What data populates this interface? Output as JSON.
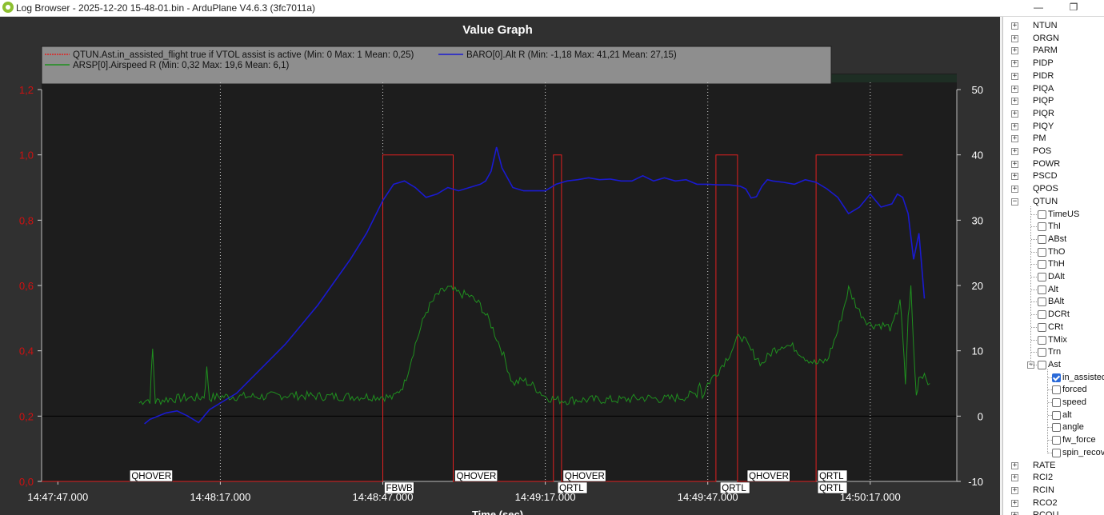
{
  "window": {
    "title": "Log Browser - 2025-12-20 15-48-01.bin - ArduPlane V4.6.3 (3fc7011a)",
    "min_label": "—",
    "max_label": "❐"
  },
  "colors": {
    "series_ast": "#e02020",
    "series_baro": "#1a1ad0",
    "series_arsp": "#1f8f1f",
    "left_axis_text": "#d01010"
  },
  "chart_data": {
    "type": "line",
    "title": "Value Graph",
    "xlabel": "Time (sec)",
    "x_range_sec": [
      -3,
      138
    ],
    "x_ticks": [
      {
        "t": 0,
        "label": "14:47:47.000"
      },
      {
        "t": 30,
        "label": "14:48:17.000"
      },
      {
        "t": 60,
        "label": "14:48:47.000"
      },
      {
        "t": 90,
        "label": "14:49:17.000"
      },
      {
        "t": 120,
        "label": "14:49:47.000"
      },
      {
        "t": 150,
        "label": "14:50:17.000"
      }
    ],
    "y_left": {
      "range": [
        0,
        1.2
      ],
      "ticks": [
        "0,0",
        "0,2",
        "0,4",
        "0,6",
        "0,8",
        "1,0",
        "1,2"
      ],
      "values": [
        0,
        0.2,
        0.4,
        0.6,
        0.8,
        1.0,
        1.2
      ]
    },
    "y_right": {
      "range": [
        -10,
        50
      ],
      "ticks": [
        "-10",
        "0",
        "10",
        "20",
        "30",
        "40",
        "50"
      ],
      "values": [
        -10,
        0,
        10,
        20,
        30,
        40,
        50
      ]
    },
    "legend": [
      {
        "name": "QTUN.Ast.in_assisted_flight true if VTOL assist is active (Min: 0 Max: 1 Mean: 0,25)",
        "color": "#e02020"
      },
      {
        "name": "BARO[0].Alt  R (Min: -1,18 Max: 41,21 Mean: 27,15)",
        "color": "#1a1ad0"
      },
      {
        "name": "ARSP[0].Airspeed  R (Min: 0,32 Max: 19,6 Mean: 6,1)",
        "color": "#1f8f1f"
      }
    ],
    "mode_bands": [
      {
        "t0": -3,
        "t1": 13,
        "color": "#f07a78"
      },
      {
        "t0": 13,
        "t1": 73,
        "color": "#f7c28c"
      },
      {
        "t0": 73,
        "t1": 93,
        "color": "#2f6e4c"
      },
      {
        "t0": 93,
        "t1": 123,
        "color": "#2f6e4c"
      },
      {
        "t0": 123,
        "t1": 127,
        "color": "#2a5c40"
      },
      {
        "t0": 127,
        "t1": 141,
        "color": "#24483a"
      },
      {
        "t0": 141,
        "t1": 170,
        "color": "#1e2e24"
      }
    ],
    "modes": [
      {
        "t": 13,
        "label": "QHOVER",
        "row": 0
      },
      {
        "t": 60,
        "label": "FBWB",
        "row": 1
      },
      {
        "t": 73,
        "label": "QHOVER",
        "row": 0
      },
      {
        "t": 92,
        "label": "QRTL",
        "row": 1
      },
      {
        "t": 93,
        "label": "QHOVER",
        "row": 0
      },
      {
        "t": 122,
        "label": "QRTL",
        "row": 1
      },
      {
        "t": 127,
        "label": "QHOVER",
        "row": 0
      },
      {
        "t": 140,
        "label": "QRTL",
        "row": 0
      },
      {
        "t": 140,
        "label": "QRTL",
        "row": 1
      }
    ],
    "series": [
      {
        "name": "QTUN.Ast.in_assisted_flight",
        "axis": "left",
        "step": true,
        "x": [
          -3,
          60,
          60,
          73,
          73,
          91.5,
          91.5,
          93,
          93,
          121.5,
          121.5,
          125.5,
          125.5,
          140,
          140,
          156
        ],
        "y": [
          0,
          0,
          1,
          1,
          0,
          0,
          1,
          1,
          0,
          0,
          1,
          1,
          0,
          0,
          1,
          1
        ]
      },
      {
        "name": "BARO[0].Alt",
        "axis": "right",
        "x": [
          16,
          17,
          20,
          22,
          24,
          26,
          28,
          30,
          33,
          36,
          39,
          42,
          45,
          48,
          51,
          54,
          57,
          60,
          62,
          64,
          66,
          68,
          70,
          72,
          74,
          76,
          78,
          79,
          80,
          81,
          82,
          84,
          86,
          88,
          90,
          92,
          94,
          96,
          98,
          100,
          102,
          104,
          106,
          108,
          110,
          112,
          114,
          116,
          118,
          120,
          122,
          124,
          126,
          127,
          128,
          129,
          130,
          131,
          132,
          134,
          136,
          138,
          140,
          142,
          144,
          146,
          148,
          150,
          152,
          154,
          155,
          156,
          157,
          158,
          159,
          160
        ],
        "y": [
          -1.18,
          -0.5,
          0.5,
          0.8,
          0,
          -1,
          1,
          2,
          3.5,
          6,
          8.5,
          11,
          14,
          17,
          20.5,
          24,
          28,
          33,
          35.5,
          36,
          35,
          33.5,
          34,
          35,
          34.5,
          35,
          35.5,
          36,
          37.5,
          41.2,
          38,
          35,
          34.5,
          34.5,
          34.5,
          35.5,
          36,
          36.2,
          36.5,
          36.2,
          36.3,
          36,
          36,
          36.8,
          36,
          36.5,
          36,
          36.2,
          35.5,
          35.5,
          35.4,
          35.4,
          35.2,
          34.8,
          33.4,
          33.6,
          35.2,
          36.2,
          36,
          35.8,
          35.5,
          36.2,
          35.8,
          34.8,
          33.5,
          31,
          32,
          34,
          32,
          32.5,
          34,
          33.5,
          31,
          24,
          28,
          18
        ]
      },
      {
        "name": "ARSP[0].Airspeed",
        "axis": "right",
        "noise": true,
        "x": [
          15,
          16,
          17,
          17.5,
          18,
          20,
          24,
          26,
          27,
          27.5,
          28,
          30,
          34,
          38,
          42,
          46,
          50,
          54,
          58,
          60,
          62,
          64,
          66,
          68,
          70,
          72,
          74,
          76,
          78,
          80,
          82,
          84,
          86,
          88,
          90,
          92,
          94,
          96,
          100,
          104,
          108,
          112,
          116,
          118,
          118.5,
          119,
          120,
          122,
          124,
          126,
          128,
          130,
          132,
          134,
          136,
          138,
          140,
          142,
          144,
          146,
          148,
          150,
          152,
          154,
          155,
          155.5,
          156,
          156.5,
          157,
          157.5,
          158,
          158.5,
          159,
          160,
          161
        ],
        "y": [
          2,
          2.5,
          2.5,
          10.2,
          2.2,
          2.6,
          2.8,
          2.8,
          3,
          7.2,
          2.8,
          3,
          3,
          3,
          3.2,
          3.1,
          3,
          3,
          3,
          3,
          2.8,
          5,
          11,
          16,
          18.5,
          19.6,
          18.8,
          18.4,
          17,
          14,
          10,
          5,
          5.5,
          4.5,
          3,
          2.5,
          2.4,
          2.5,
          2.5,
          2.5,
          2.8,
          2.6,
          3,
          3.5,
          5.5,
          3,
          5,
          7,
          9.5,
          12.5,
          10,
          8,
          10,
          11,
          10.5,
          9,
          8,
          8.5,
          13,
          19.5,
          16,
          14,
          14,
          13.5,
          16,
          18,
          12,
          5,
          15,
          19.6,
          10.5,
          3,
          6,
          6.5,
          5
        ]
      }
    ]
  },
  "tree": {
    "items": [
      {
        "label": "NTUN",
        "level": 0,
        "exp": "+"
      },
      {
        "label": "ORGN",
        "level": 0,
        "exp": "+"
      },
      {
        "label": "PARM",
        "level": 0,
        "exp": "+"
      },
      {
        "label": "PIDP",
        "level": 0,
        "exp": "+"
      },
      {
        "label": "PIDR",
        "level": 0,
        "exp": "+"
      },
      {
        "label": "PIQA",
        "level": 0,
        "exp": "+"
      },
      {
        "label": "PIQP",
        "level": 0,
        "exp": "+"
      },
      {
        "label": "PIQR",
        "level": 0,
        "exp": "+"
      },
      {
        "label": "PIQY",
        "level": 0,
        "exp": "+"
      },
      {
        "label": "PM",
        "level": 0,
        "exp": "+"
      },
      {
        "label": "POS",
        "level": 0,
        "exp": "+"
      },
      {
        "label": "POWR",
        "level": 0,
        "exp": "+"
      },
      {
        "label": "PSCD",
        "level": 0,
        "exp": "+"
      },
      {
        "label": "QPOS",
        "level": 0,
        "exp": "+"
      },
      {
        "label": "QTUN",
        "level": 0,
        "exp": "−"
      },
      {
        "label": "TimeUS",
        "level": 1,
        "cb": false
      },
      {
        "label": "ThI",
        "level": 1,
        "cb": false
      },
      {
        "label": "ABst",
        "level": 1,
        "cb": false
      },
      {
        "label": "ThO",
        "level": 1,
        "cb": false
      },
      {
        "label": "ThH",
        "level": 1,
        "cb": false
      },
      {
        "label": "DAlt",
        "level": 1,
        "cb": false
      },
      {
        "label": "Alt",
        "level": 1,
        "cb": false
      },
      {
        "label": "BAlt",
        "level": 1,
        "cb": false
      },
      {
        "label": "DCRt",
        "level": 1,
        "cb": false
      },
      {
        "label": "CRt",
        "level": 1,
        "cb": false
      },
      {
        "label": "TMix",
        "level": 1,
        "cb": false
      },
      {
        "label": "Trn",
        "level": 1,
        "cb": false
      },
      {
        "label": "Ast",
        "level": 1,
        "cb": false,
        "exp": "−"
      },
      {
        "label": "in_assisted_flight",
        "level": 2,
        "cb": true
      },
      {
        "label": "forced",
        "level": 2,
        "cb": false
      },
      {
        "label": "speed",
        "level": 2,
        "cb": false
      },
      {
        "label": "alt",
        "level": 2,
        "cb": false
      },
      {
        "label": "angle",
        "level": 2,
        "cb": false
      },
      {
        "label": "fw_force",
        "level": 2,
        "cb": false
      },
      {
        "label": "spin_recovery",
        "level": 2,
        "cb": false
      },
      {
        "label": "RATE",
        "level": 0,
        "exp": "+"
      },
      {
        "label": "RCI2",
        "level": 0,
        "exp": "+"
      },
      {
        "label": "RCIN",
        "level": 0,
        "exp": "+"
      },
      {
        "label": "RCO2",
        "level": 0,
        "exp": "+"
      },
      {
        "label": "RCOU",
        "level": 0,
        "exp": "+"
      }
    ]
  }
}
